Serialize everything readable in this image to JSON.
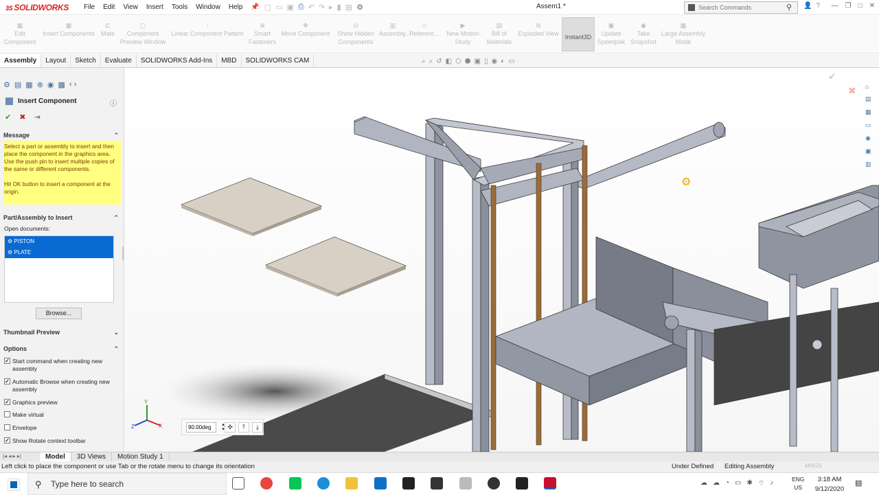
{
  "app": {
    "logo": "SOLIDWORKS",
    "logo_prefix": "3S",
    "doc_title": "Assem1 *"
  },
  "menus": [
    "File",
    "Edit",
    "View",
    "Insert",
    "Tools",
    "Window",
    "Help"
  ],
  "search": {
    "placeholder": "Search Commands"
  },
  "commands": [
    {
      "label": "Edit\nComponent"
    },
    {
      "label": "Insert Components"
    },
    {
      "label": "Mate"
    },
    {
      "label": "Component\nPreview Window"
    },
    {
      "label": "Linear Component Pattern"
    },
    {
      "label": "Smart\nFasteners"
    },
    {
      "label": "Move Component"
    },
    {
      "label": "Show Hidden\nComponents"
    },
    {
      "label": "Assembly..."
    },
    {
      "label": "Referenc..."
    },
    {
      "label": "New Motion\nStudy"
    },
    {
      "label": "Bill of\nMaterials"
    },
    {
      "label": "Exploded View"
    },
    {
      "label": "Instant3D"
    },
    {
      "label": "Update\nSpeedpak"
    },
    {
      "label": "Take\nSnapshot"
    },
    {
      "label": "Large Assembly\nMode"
    }
  ],
  "tabs": [
    "Assembly",
    "Layout",
    "Sketch",
    "Evaluate",
    "SOLIDWORKS Add-Ins",
    "MBD",
    "SOLIDWORKS CAM"
  ],
  "panel": {
    "title": "Insert Component",
    "message_header": "Message",
    "message_p1": "Select a part or assembly to insert and then place the component in the graphics area. Use the push pin to insert multiple copies of the same or different components.",
    "message_p2": "Hit OK button to insert a component at the origin.",
    "part_header": "Part/Assembly to Insert",
    "open_docs": "Open documents:",
    "documents": [
      "PISTON",
      "PLATE"
    ],
    "browse": "Browse...",
    "thumb_header": "Thumbnail Preview",
    "options_header": "Options",
    "options": [
      {
        "label": "Start command when creating new assembly",
        "checked": true
      },
      {
        "label": "Automatic Browse when creating new assembly",
        "checked": true
      },
      {
        "label": "Graphics preview",
        "checked": true
      },
      {
        "label": "Make virtual",
        "checked": false
      },
      {
        "label": "Envelope",
        "checked": false
      },
      {
        "label": "Show Rotate context toolbar",
        "checked": true
      }
    ]
  },
  "rotate": {
    "value": "90.00deg"
  },
  "bottom_tabs": [
    "Model",
    "3D Views",
    "Motion Study 1"
  ],
  "status": {
    "hint": "Left click to place the component or use Tab or the rotate menu to change its orientation",
    "state": "Under Defined",
    "mode": "Editing Assembly",
    "units": "MMGS"
  },
  "taskbar": {
    "search_placeholder": "Type here to search",
    "lang": "ENG",
    "region": "US",
    "time": "3:18 AM",
    "date": "9/12/2020"
  }
}
